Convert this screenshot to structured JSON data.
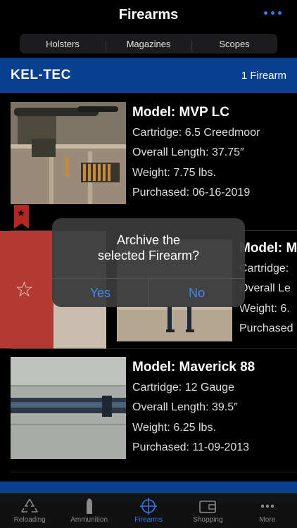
{
  "nav": {
    "title": "Firearms",
    "more_icon": "ellipsis-icon"
  },
  "segments": [
    "Holsters",
    "Magazines",
    "Scopes"
  ],
  "section": {
    "title": "KEL-TEC",
    "count": "1 Firearm"
  },
  "rows": [
    {
      "model": "Model: MVP LC",
      "cartridge": "Cartridge: 6.5 Creedmoor",
      "length": "Overall Length: 37.75″",
      "weight": "Weight: 7.75 lbs.",
      "purchased": "Purchased: 06-16-2019",
      "favorite": true
    },
    {
      "model": "Model: M",
      "cartridge": "Cartridge:",
      "length": "Overall Le",
      "weight": "Weight: 6.",
      "purchased": "Purchased"
    },
    {
      "model": "Model: Maverick 88",
      "cartridge": "Cartridge: 12 Gauge",
      "length": "Overall Length: 39.5″",
      "weight": "Weight: 6.25 lbs.",
      "purchased": "Purchased: 11-09-2013"
    }
  ],
  "alert": {
    "title": "Archive the\nselected Firearm?",
    "yes": "Yes",
    "no": "No"
  },
  "tabs": [
    {
      "label": "Reloading",
      "icon": "recycle-icon",
      "active": false
    },
    {
      "label": "Ammunition",
      "icon": "bullet-icon",
      "active": false
    },
    {
      "label": "Firearms",
      "icon": "crosshair-icon",
      "active": true
    },
    {
      "label": "Shopping",
      "icon": "wallet-icon",
      "active": false
    },
    {
      "label": "More",
      "icon": "ellipsis-icon",
      "active": false
    }
  ],
  "colors": {
    "accent": "#2f7bf5",
    "section_bg": "#0b3f8f",
    "favorite": "#b12721",
    "alert_button": "#3d8af7"
  }
}
